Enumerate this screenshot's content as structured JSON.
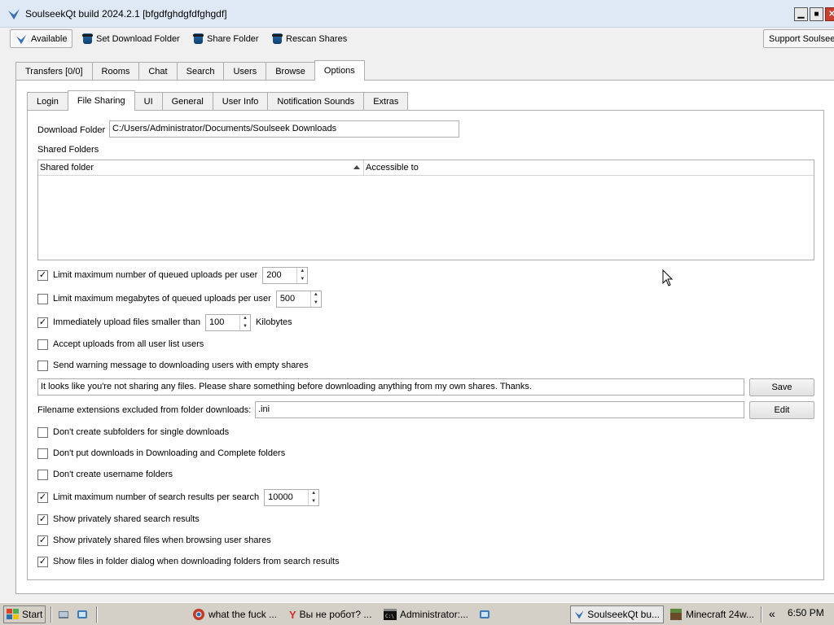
{
  "window": {
    "title": "SoulseekQt build 2024.2.1 [bfgdfghdgfdfghgdf]",
    "min": "▁",
    "max": "■",
    "close": "✕"
  },
  "toolbar": {
    "available": "Available",
    "set_download_folder": "Set Download Folder",
    "share_folder": "Share Folder",
    "rescan_shares": "Rescan Shares",
    "support": "Support Soulseek"
  },
  "tabs": [
    "Transfers [0/0]",
    "Rooms",
    "Chat",
    "Search",
    "Users",
    "Browse",
    "Options"
  ],
  "subtabs": [
    "Login",
    "File Sharing",
    "UI",
    "General",
    "User Info",
    "Notification Sounds",
    "Extras"
  ],
  "file_sharing": {
    "download_folder_label": "Download Folder",
    "download_folder_value": "C:/Users/Administrator/Documents/Soulseek Downloads",
    "shared_folders_label": "Shared Folders",
    "table_headers": [
      "Shared folder",
      "Accessible to"
    ],
    "limit_queued_uploads": {
      "label": "Limit maximum number of queued uploads per user",
      "checked": "✓",
      "value": "200"
    },
    "limit_megabytes": {
      "label": "Limit maximum megabytes of queued uploads per user",
      "checked": "",
      "value": "500"
    },
    "immediately_upload": {
      "label": "Immediately upload files smaller than",
      "checked": "✓",
      "value": "100",
      "unit": "Kilobytes"
    },
    "accept_uploads": {
      "label": "Accept uploads from all user list users",
      "checked": ""
    },
    "send_warning": {
      "label": "Send warning message to downloading users with empty shares",
      "checked": ""
    },
    "warning_message": "It looks like you're not sharing any files. Please share something before downloading anything from my own shares. Thanks.",
    "save_label": "Save",
    "excluded_ext_label": "Filename extensions excluded from folder downloads:",
    "excluded_ext_value": ".ini",
    "edit_label": "Edit",
    "no_subfolders": {
      "label": "Don't create subfolders for single downloads",
      "checked": ""
    },
    "no_downloading_folders": {
      "label": "Don't put downloads in Downloading and Complete folders",
      "checked": ""
    },
    "no_username_folders": {
      "label": "Don't create username folders",
      "checked": ""
    },
    "limit_search_results": {
      "label": "Limit maximum number of search results per search",
      "checked": "✓",
      "value": "10000"
    },
    "show_private_search": {
      "label": "Show privately shared search results",
      "checked": "✓"
    },
    "show_private_browse": {
      "label": "Show privately shared files when browsing user shares",
      "checked": "✓"
    },
    "show_folder_dialog": {
      "label": "Show files in folder dialog when downloading folders from search results",
      "checked": "✓"
    }
  },
  "taskbar": {
    "start": "Start",
    "tasks": [
      "what the fuck ...",
      "Вы не робот? ...",
      "Administrator:...",
      "SoulseekQt bu...",
      "Minecraft 24w..."
    ],
    "expand": "«",
    "clock": "6:50 PM"
  },
  "colors": {
    "accent": "#2b6fb0",
    "titlebar": "#dfe9f5",
    "close": "#c8402e"
  }
}
